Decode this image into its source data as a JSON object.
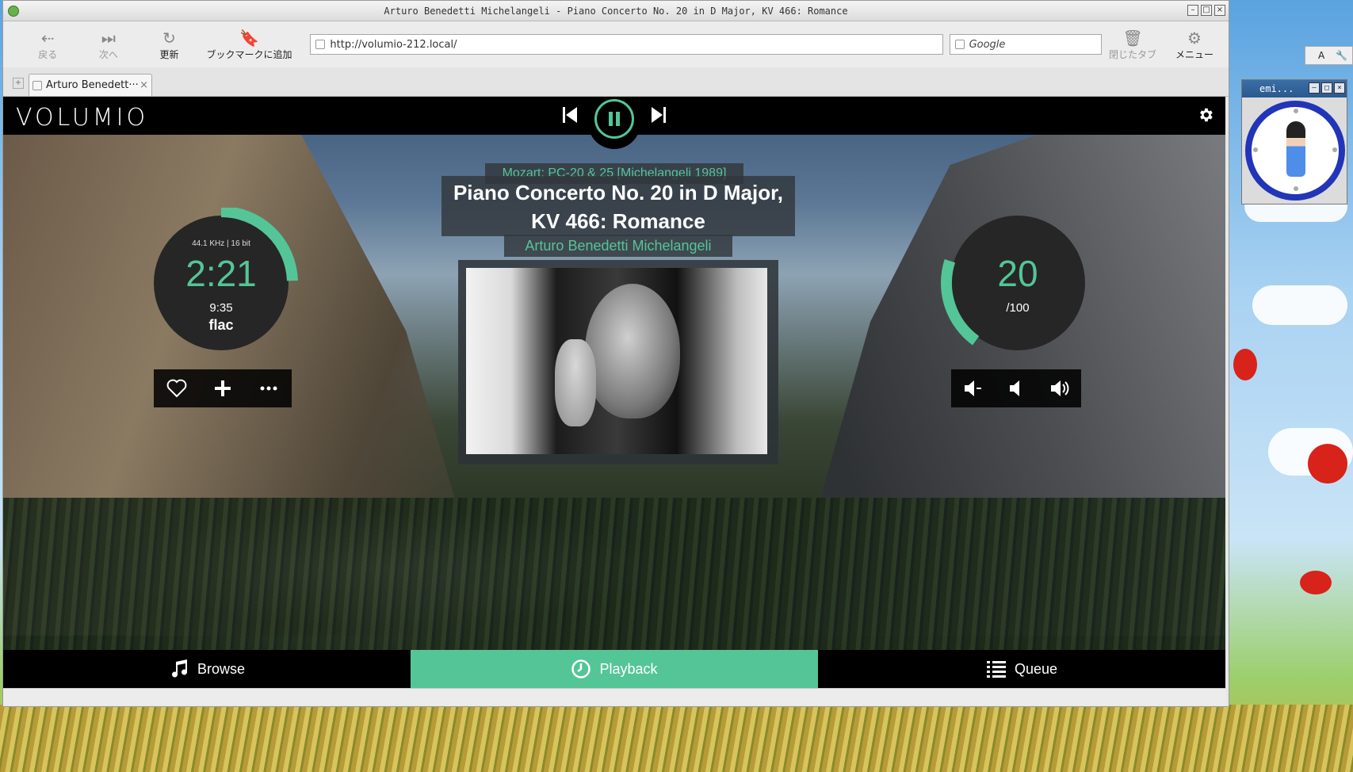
{
  "window": {
    "title": "Arturo Benedetti Michelangeli - Piano Concerto No. 20 in D Major, KV 466: Romance",
    "controls": [
      "–",
      "□",
      "×"
    ]
  },
  "toolbar": {
    "back_label": "戻る",
    "forward_label": "次へ",
    "reload_label": "更新",
    "bookmark_label": "ブックマークに追加",
    "url": "http://volumio-212.local/",
    "search_placeholder": "Google",
    "closed_tabs_label": "閉じたタブ",
    "menu_label": "メニュー"
  },
  "tabs": [
    {
      "label": "Arturo Benedett···",
      "close": "×"
    }
  ],
  "volumio": {
    "logo": "VOLUMIO",
    "album": "Mozart; PC-20 & 25 [Michelangeli 1989]",
    "title": "Piano Concerto No. 20 in D Major, KV 466: Romance",
    "artist": "Arturo Benedetti Michelangeli",
    "samplerate": "44.1 KHz | 16 bit",
    "elapsed": "2:21",
    "duration": "9:35",
    "codec": "flac",
    "progress_fraction": 0.245,
    "volume": "20",
    "volume_max": "/100",
    "volume_fraction": 0.2,
    "accent_color": "#54c597",
    "nav": {
      "browse": "Browse",
      "playback": "Playback",
      "queue": "Queue"
    }
  },
  "desktop": {
    "ime_label": "A",
    "clock_title": "emi..."
  }
}
